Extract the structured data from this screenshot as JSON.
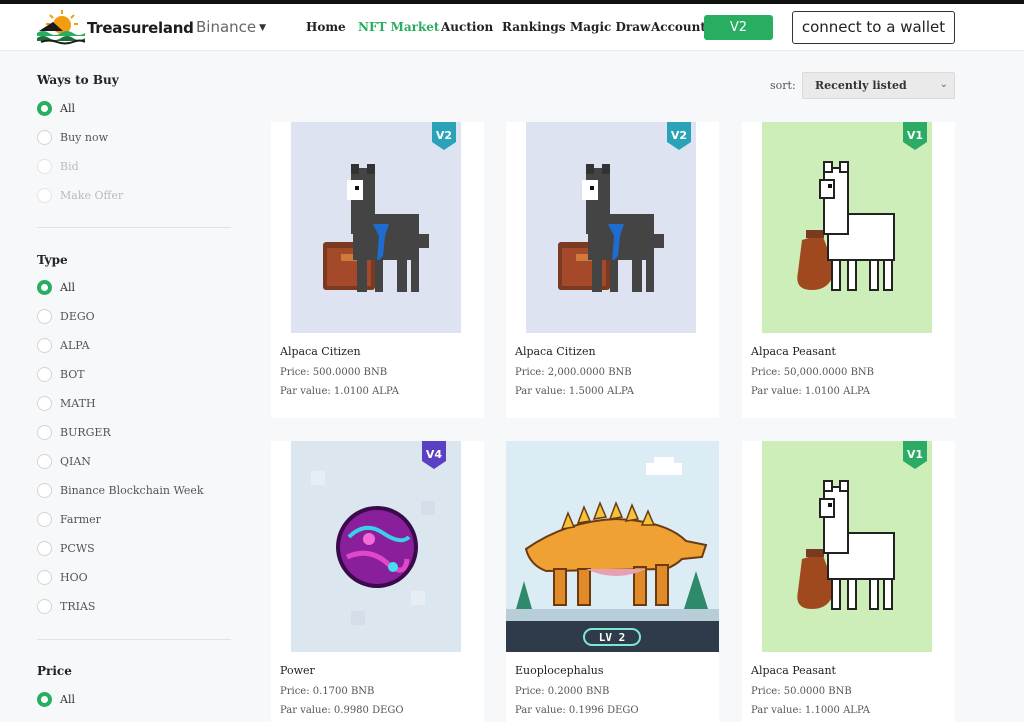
{
  "header": {
    "brand": "Treasureland",
    "network": "Binance",
    "nav": [
      "Home",
      "NFT Market",
      "Auction",
      "Rankings",
      "Magic Draw",
      "Account"
    ],
    "active_nav": "NFT Market",
    "version_button": "V2",
    "wallet_button": "connect to a wallet"
  },
  "sidebar": {
    "ways_to_buy": {
      "title": "Ways to Buy",
      "options": [
        "All",
        "Buy now",
        "Bid",
        "Make Offer"
      ],
      "selected": "All"
    },
    "type": {
      "title": "Type",
      "options": [
        "All",
        "DEGO",
        "ALPA",
        "BOT",
        "MATH",
        "BURGER",
        "QIAN",
        "Binance Blockchain Week",
        "Farmer",
        "PCWS",
        "HOO",
        "TRIAS"
      ],
      "selected": "All"
    },
    "price": {
      "title": "Price",
      "options": [
        "All"
      ],
      "selected": "All"
    }
  },
  "sort": {
    "label": "sort:",
    "value": "Recently listed"
  },
  "cards": [
    {
      "name": "Alpaca Citizen",
      "price": "Price:   500.0000 BNB",
      "par": "Par value: 1.0100 ALPA",
      "badge": "V2"
    },
    {
      "name": "Alpaca Citizen",
      "price": "Price:   2,000.0000 BNB",
      "par": "Par value: 1.5000 ALPA",
      "badge": "V2"
    },
    {
      "name": "Alpaca Peasant",
      "price": "Price:   50,000.0000 BNB",
      "par": "Par value: 1.0100 ALPA",
      "badge": "V1"
    },
    {
      "name": "Power",
      "price": "Price:   0.1700 BNB",
      "par": "Par value: 0.9980 DEGO",
      "badge": "V4"
    },
    {
      "name": "Euoplocephalus",
      "price": "Price:   0.2000 BNB",
      "par": "Par value: 0.1996 DEGO",
      "badge": "LV 2"
    },
    {
      "name": "Alpaca Peasant",
      "price": "Price:   50.0000 BNB",
      "par": "Par value: 1.1000 ALPA",
      "badge": "V1"
    }
  ],
  "colors": {
    "accent": "#27ae60",
    "badge_teal": "#2aa3b8",
    "badge_green": "#2bab63",
    "badge_purple": "#5b3fc4",
    "card_bg_blue": "#dde3f0",
    "card_bg_green": "#cdeeb8"
  },
  "icons": [
    "logo-icon",
    "caret-down-icon",
    "chevron-down-icon"
  ]
}
